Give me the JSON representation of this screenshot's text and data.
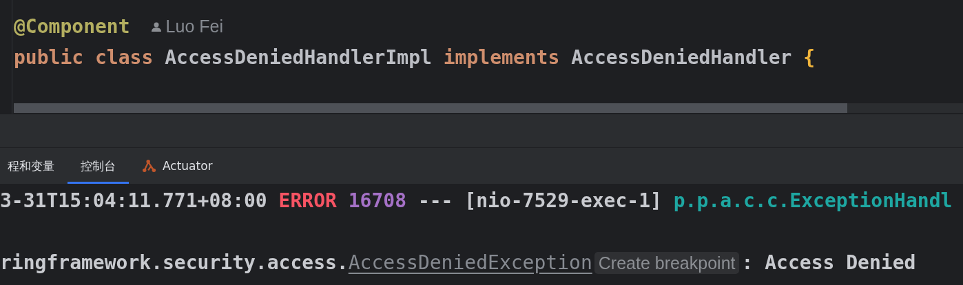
{
  "editor": {
    "lines": [
      {
        "tokens": [
          {
            "text": "@Component",
            "kind": "annotation"
          }
        ],
        "author": "Luo Fei"
      },
      {
        "tokens": [
          {
            "text": "public",
            "kind": "keyword"
          },
          {
            "text": " class",
            "kind": "keyword"
          },
          {
            "text": " AccessDeniedHandlerImpl ",
            "kind": "plain"
          },
          {
            "text": "implements",
            "kind": "keyword"
          },
          {
            "text": " AccessDeniedHandler ",
            "kind": "plain"
          },
          {
            "text": "{",
            "kind": "brace"
          }
        ]
      }
    ]
  },
  "tabs": [
    {
      "label": "程和变量",
      "selected": false,
      "icon": false
    },
    {
      "label": "控制台",
      "selected": true,
      "icon": false
    },
    {
      "label": "Actuator",
      "selected": false,
      "icon": true
    }
  ],
  "console": {
    "lines": [
      {
        "tokens": [
          {
            "text": "3-31T15:04:11.771+08:00 ",
            "kind": "plain"
          },
          {
            "text": "ERROR",
            "kind": "error"
          },
          {
            "text": " 16708",
            "kind": "pid"
          },
          {
            "text": " --- [nio-7529-exec-1] ",
            "kind": "plain"
          },
          {
            "text": "p.p.a.c.c.ExceptionHandl",
            "kind": "logger"
          }
        ]
      },
      {
        "tokens": [
          {
            "text": "ringframework.security.access.",
            "kind": "plain"
          },
          {
            "text": "AccessDeniedException",
            "kind": "link"
          },
          {
            "text": "Create breakpoint",
            "kind": "hint"
          },
          {
            "text": ": Access Denied",
            "kind": "plain"
          }
        ]
      }
    ]
  }
}
